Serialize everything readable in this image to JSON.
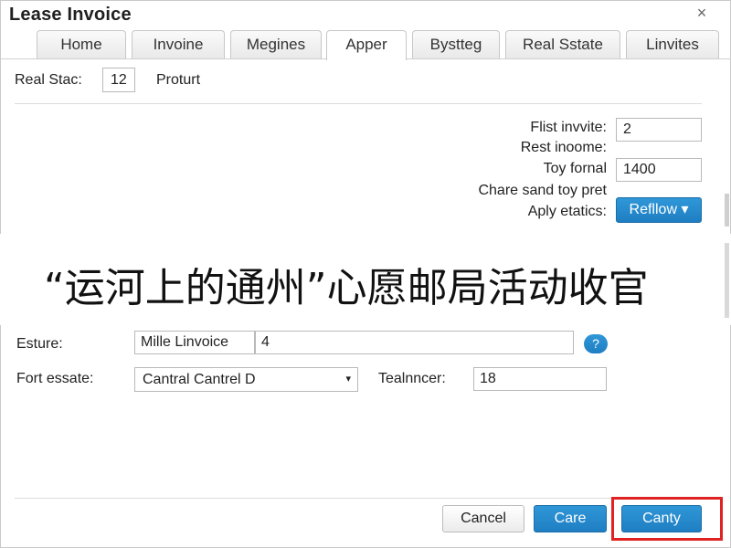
{
  "window": {
    "title": "Lease Invoice",
    "close_glyph": "×"
  },
  "tabs": [
    {
      "label": "Home",
      "active": false
    },
    {
      "label": "Invoine",
      "active": false
    },
    {
      "label": "Megines",
      "active": false
    },
    {
      "label": "Apper",
      "active": true
    },
    {
      "label": "Bystteg",
      "active": false
    },
    {
      "label": "Real Sstate",
      "active": false
    },
    {
      "label": "Linvites",
      "active": false
    }
  ],
  "top_row": {
    "label": "Real Stac:",
    "value": "12",
    "text": "Proturt"
  },
  "right_form": {
    "first_invite_label": "Flist invvite:",
    "first_invite_value": "2",
    "rest_income_label": "Rest inoome:",
    "toy_formal_label": "Toy fornal",
    "toy_formal_value": "1400",
    "chare_label": "Chare sand toy pret",
    "apply_label": "Aply etatics:",
    "reflow_button": "Refllow ▾"
  },
  "banner": {
    "text": "“运河上的通州”心愿邮局活动收官"
  },
  "lower_form": {
    "esture_label": "Esture:",
    "esture_name": "Mille Linvoice",
    "esture_value": "4",
    "help_icon": "?",
    "fort_label": "Fort essate:",
    "fort_select": "Cantral Cantrel D",
    "caret": "▾",
    "team_label": "Tealnncer:",
    "team_value": "18"
  },
  "footer": {
    "cancel": "Cancel",
    "care": "Care",
    "canty": "Canty"
  },
  "colors": {
    "accent": "#1f7ec2",
    "highlight": "#e02222"
  }
}
